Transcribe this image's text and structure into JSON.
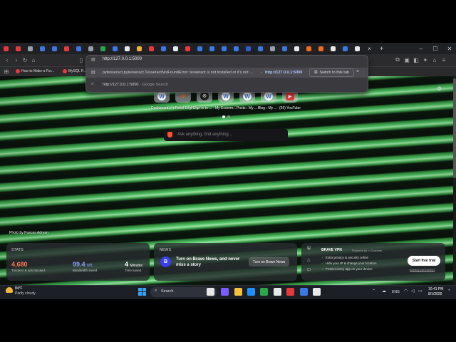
{
  "tabs": {
    "favicon_colors": [
      "#e83a3a",
      "#e83a3a",
      "#9aa0a6",
      "#3b78e7",
      "#3b78e7",
      "#e83a3a",
      "#3b78e7",
      "#9aa0a6",
      "#2aa84a",
      "#3b78e7",
      "#e8e8e8",
      "#f2b233",
      "#e83a3a",
      "#3b78e7",
      "#e8e8e8",
      "#e83a3a",
      "#3b78e7",
      "#3b78e7",
      "#3b78e7",
      "#3b78e7",
      "#2f5bd6",
      "#3b78e7",
      "#9aa0a6",
      "#3b78e7",
      "#e8e8e8",
      "#f06a1f",
      "#f06a1f",
      "#e8e8e8",
      "#3b78e7",
      "#e8e8e8"
    ],
    "close_glyph": "×",
    "new_tab_glyph": "+"
  },
  "window_controls": {
    "min": "–",
    "max": "☐",
    "close": "✕"
  },
  "nav": {
    "back": "‹",
    "forward": "›",
    "reload": "↻",
    "home": "⌂"
  },
  "bookmarks": [
    {
      "label": "How to Make a Fur...",
      "color": "#e83a3a"
    },
    {
      "label": "MySQL R...",
      "color": "#e83a3a"
    }
  ],
  "omnibox": {
    "input_value": "http://127.0.0.1:5000",
    "suggestion_1_text": "pytesseract.pytesseract.TesseractNotFoundError: tesseract is not installed or it's not ...",
    "suggestion_1_dash": "-",
    "suggestion_1_url": "http://127.0.0.1:5000",
    "switch_tab_label": "Switch to this tab",
    "close_glyph": "×",
    "suggestion_2_url": "http://127.0.0.1:5000",
    "suggestion_2_suffix": "- Google Search"
  },
  "top_sites": [
    {
      "label": "Dashboard...",
      "icon": "W",
      "color": "#3b78e7"
    },
    {
      "label": "cPanel Login",
      "icon": "cP",
      "color": "#f06a1f"
    },
    {
      "label": "Sign in to ...",
      "icon": "⌾",
      "color": "#ffffff"
    },
    {
      "label": "My Ecomm...",
      "icon": "W",
      "color": "#3b78e7"
    },
    {
      "label": "Posts ‹ My ...",
      "icon": "W",
      "color": "#3b78e7"
    },
    {
      "label": "Blog ‹ My ...",
      "icon": "W",
      "color": "#3b78e7"
    },
    {
      "label": "(55) YouTube",
      "icon": "▶",
      "color": "#e83a3a"
    }
  ],
  "search": {
    "placeholder": "Ask anything, find anything..."
  },
  "photo_credit": "Photo by Pueces Adryan",
  "stats": {
    "heading": "STATS",
    "trackers_value": "4,680",
    "trackers_label": "Trackers & ads blocked",
    "bandwidth_value": "99.4",
    "bandwidth_unit": "MB",
    "bandwidth_label": "Bandwidth saved",
    "time_value": "4",
    "time_unit": "Minutes",
    "time_label": "Time saved",
    "colors": {
      "trackers": "#ff7a52",
      "bandwidth": "#8f9cff",
      "time": "#ffffff"
    }
  },
  "news": {
    "heading": "NEWS",
    "text": "Turn on Brave News, and never miss a story",
    "button": "Turn on Brave News"
  },
  "vpn": {
    "title": "BRAVE VPN",
    "powered": "Powered by ⌁ Guardian",
    "features": [
      "Extra privacy & security online",
      "Hide your IP & change your location",
      "Protect every app on your device"
    ],
    "check": "✓",
    "button": "Start free trial",
    "link": "Already purchased?"
  },
  "taskbar": {
    "weather_temp": "84°F",
    "weather_desc": "Partly cloudy",
    "search_label": "Search",
    "app_colors": [
      "#e6e6e6",
      "#7b5cff",
      "#f3c13a",
      "#1e90ff",
      "#2aa84a",
      "#e8e8e8",
      "#e83a3a",
      "#3b78e7",
      "#e8e8e8"
    ],
    "lang": "ENG",
    "time": "10:41 PM",
    "date": "8/1/2026"
  }
}
